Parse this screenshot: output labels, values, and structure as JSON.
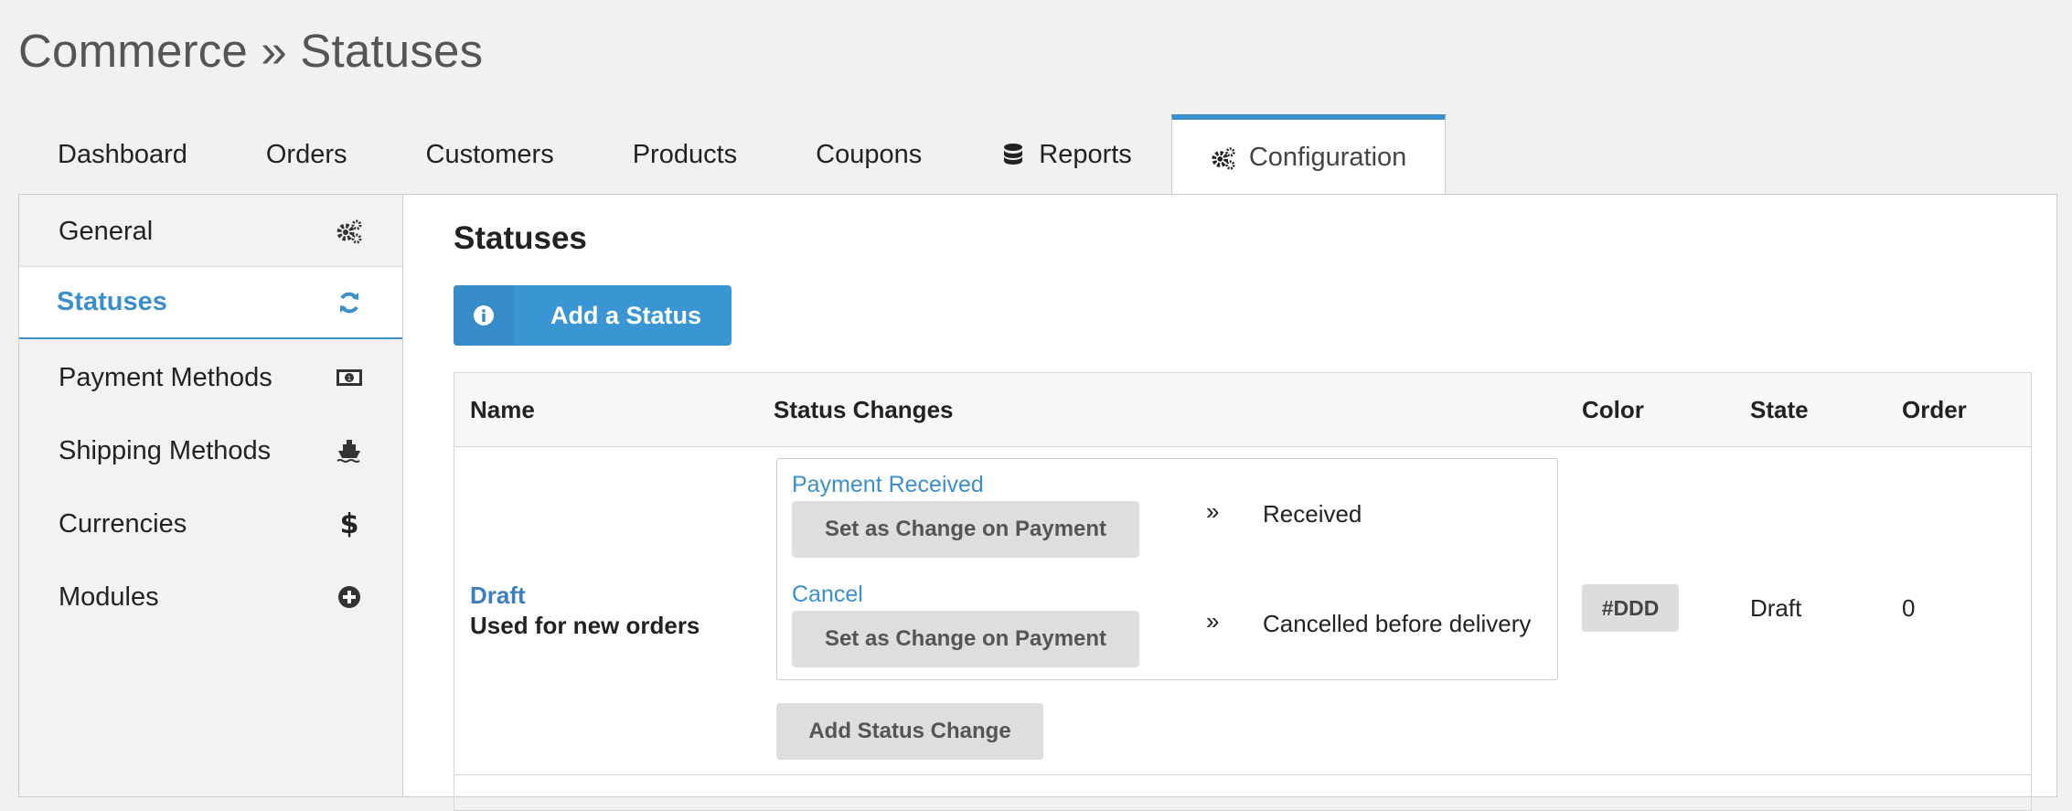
{
  "page": {
    "title": "Commerce » Statuses"
  },
  "tabs": [
    {
      "label": "Dashboard",
      "icon": ""
    },
    {
      "label": "Orders",
      "icon": ""
    },
    {
      "label": "Customers",
      "icon": ""
    },
    {
      "label": "Products",
      "icon": ""
    },
    {
      "label": "Coupons",
      "icon": ""
    },
    {
      "label": "Reports",
      "icon": "database-icon"
    },
    {
      "label": "Configuration",
      "icon": "gears-icon",
      "active": true
    }
  ],
  "sidebar": {
    "items": [
      {
        "label": "General",
        "icon": "gears-icon"
      },
      {
        "label": "Statuses",
        "icon": "refresh-icon",
        "active": true
      },
      {
        "label": "Payment Methods",
        "icon": "money-icon"
      },
      {
        "label": "Shipping Methods",
        "icon": "ship-icon"
      },
      {
        "label": "Currencies",
        "icon": "dollar-icon"
      },
      {
        "label": "Modules",
        "icon": "plus-circle-icon"
      }
    ]
  },
  "main": {
    "title": "Statuses",
    "add_button": {
      "label": "Add a Status",
      "icon": "info-circle-icon"
    },
    "table": {
      "headers": [
        "Name",
        "Status Changes",
        "Color",
        "State",
        "Order"
      ],
      "rows": [
        {
          "name": "Draft",
          "description": "Used for new orders",
          "changes": [
            {
              "event": "Payment Received",
              "button": "Set as Change on Payment",
              "target": "Received"
            },
            {
              "event": "Cancel",
              "button": "Set as Change on Payment",
              "target": "Cancelled before delivery"
            }
          ],
          "add_change_label": "Add Status Change",
          "color": "#DDD",
          "state": "Draft",
          "order": "0"
        }
      ]
    }
  },
  "colors": {
    "accent": "#3b8fcb",
    "primary_button": "#3996d2",
    "badge_bg": "#dddddd"
  }
}
